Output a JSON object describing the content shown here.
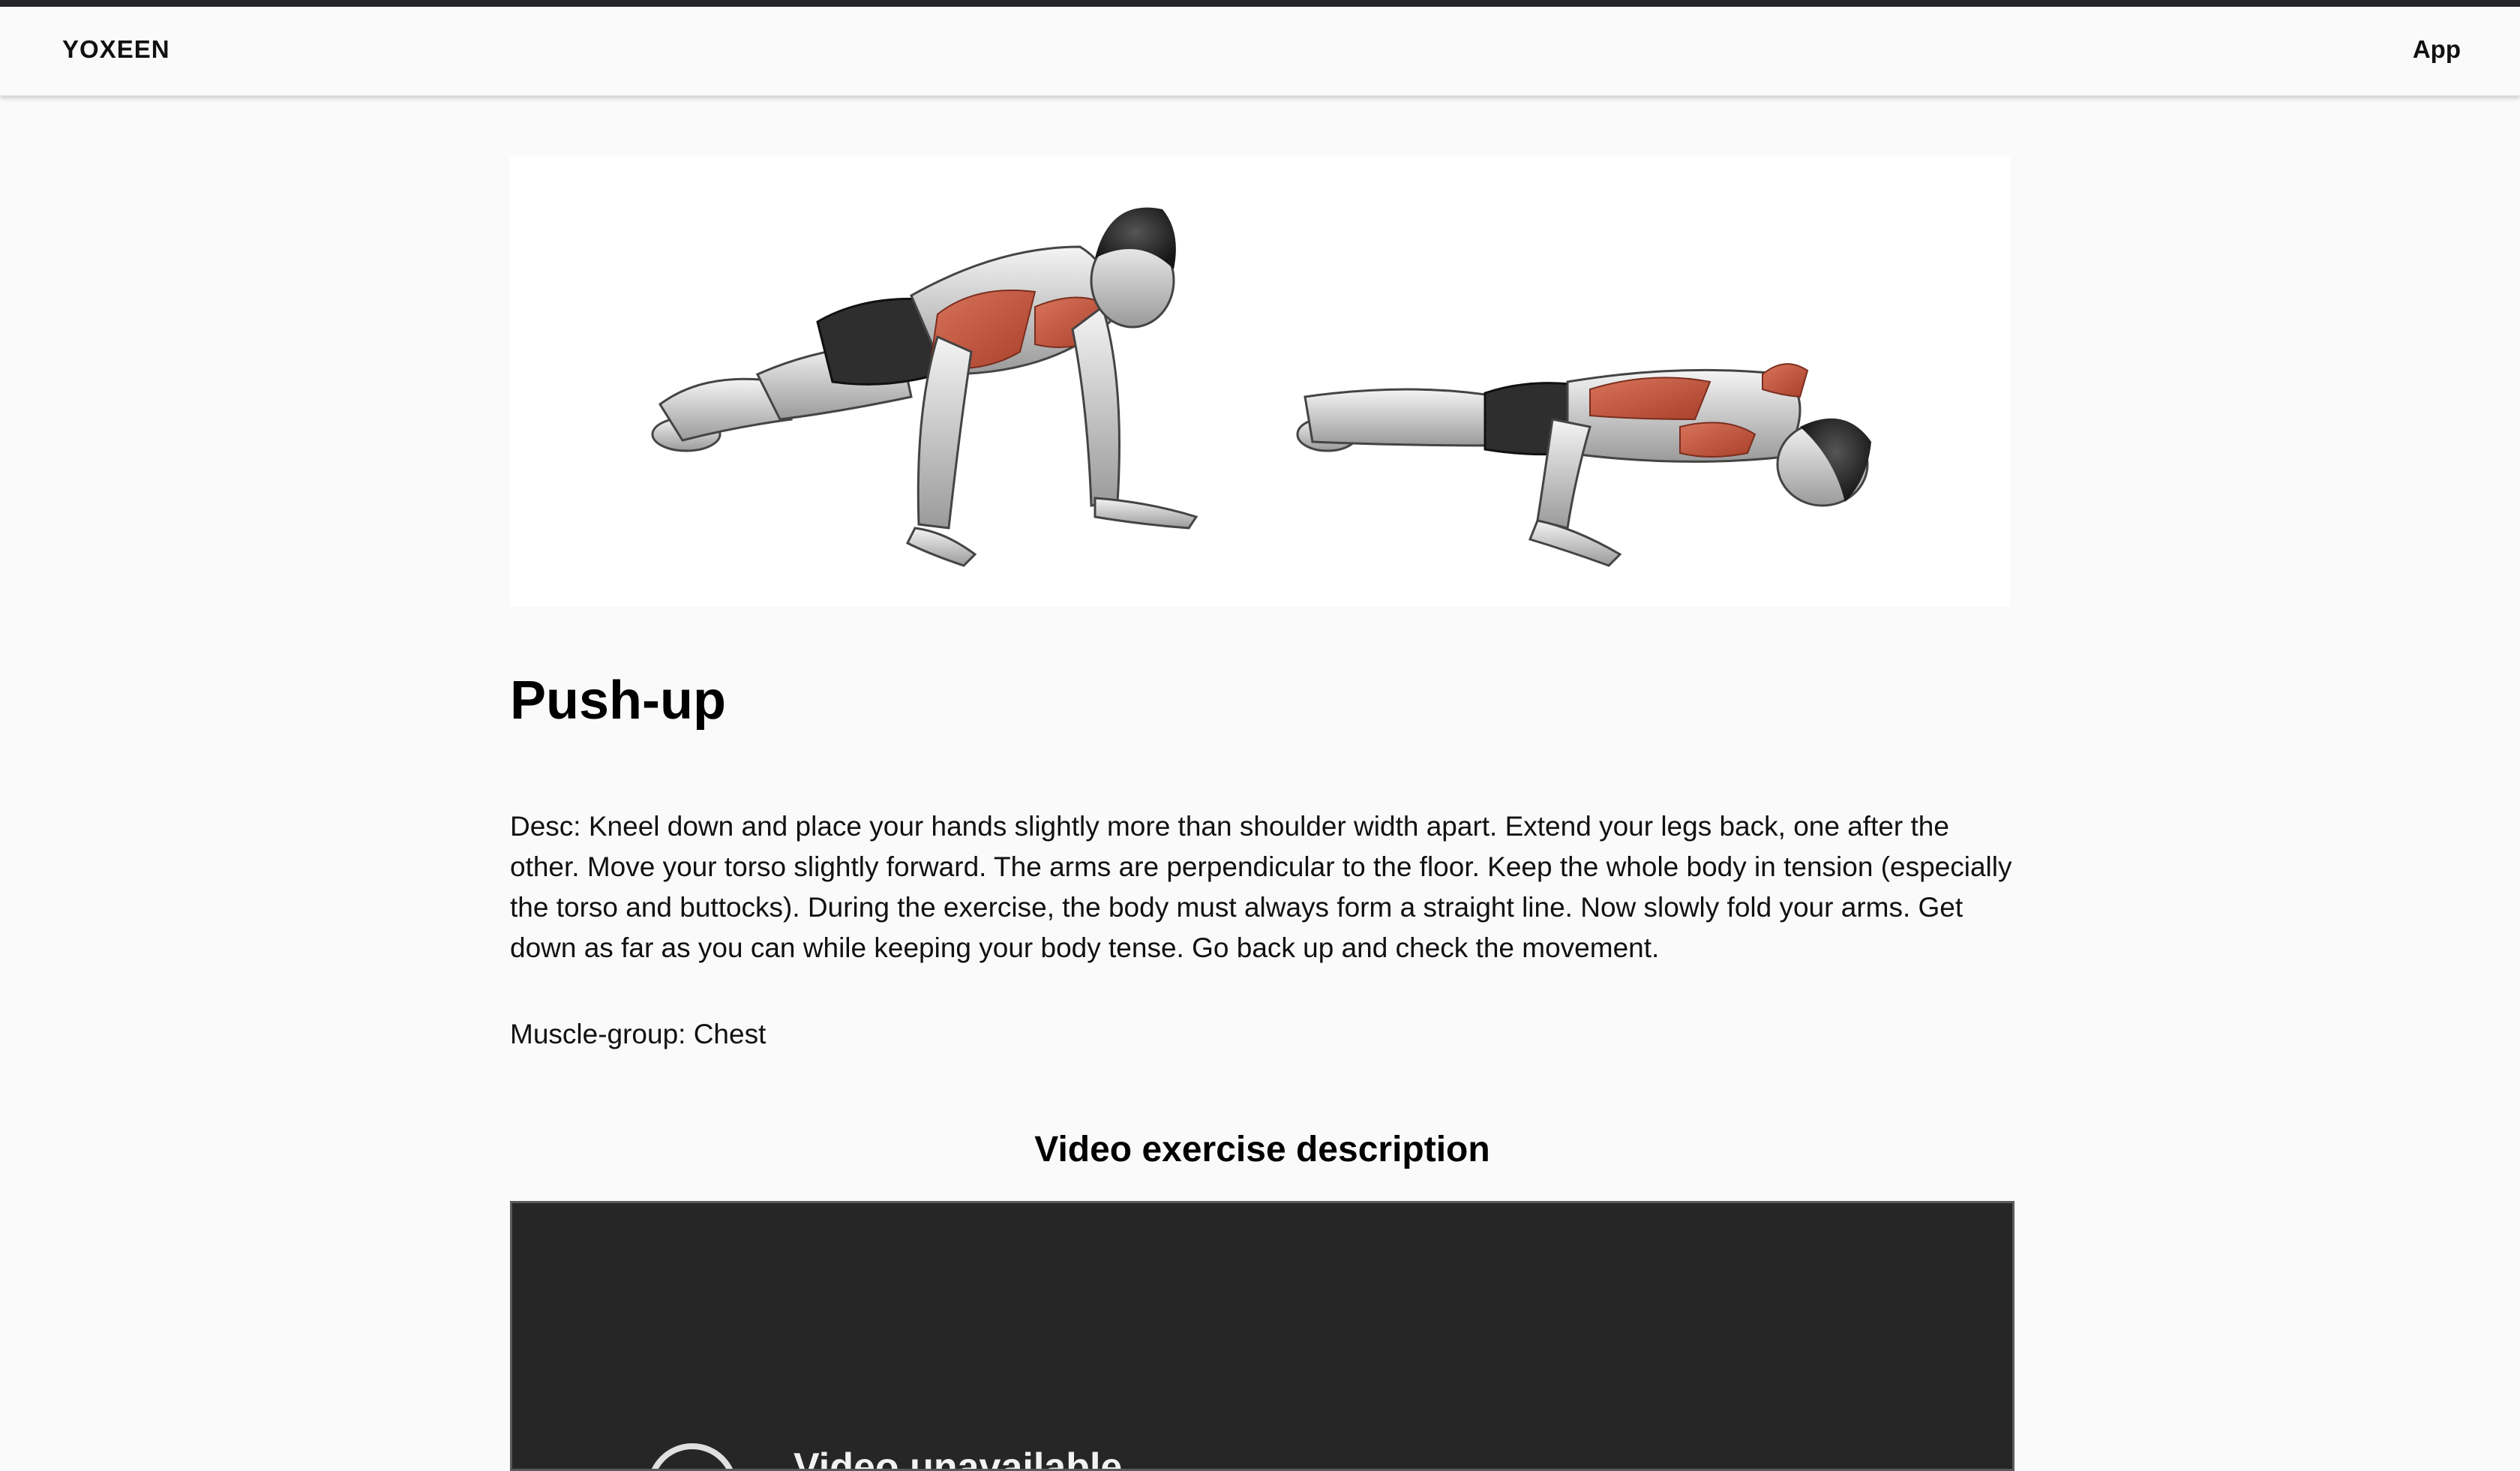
{
  "navbar": {
    "brand": "YOXEEN",
    "app_link": "App"
  },
  "exercise": {
    "image_alt": "Push-up illustration",
    "title": "Push-up",
    "description": "Desc: Kneel down and place your hands slightly more than shoulder width apart. Extend your legs back, one after the other. Move your torso slightly forward. The arms are perpendicular to the floor. Keep the whole body in tension (especially the torso and buttocks). During the exercise, the body must always form a straight line. Now slowly fold your arms. Get down as far as you can while keeping your body tense. Go back up and check the movement.",
    "muscle_group": "Muscle-group: Chest"
  },
  "video": {
    "heading": "Video exercise description",
    "unavailable_message": "Video unavailable"
  },
  "colors": {
    "topline": "#25252a",
    "page_bg": "#fafafa",
    "video_bg": "#262626",
    "muscle_highlight": "#c4553a"
  }
}
